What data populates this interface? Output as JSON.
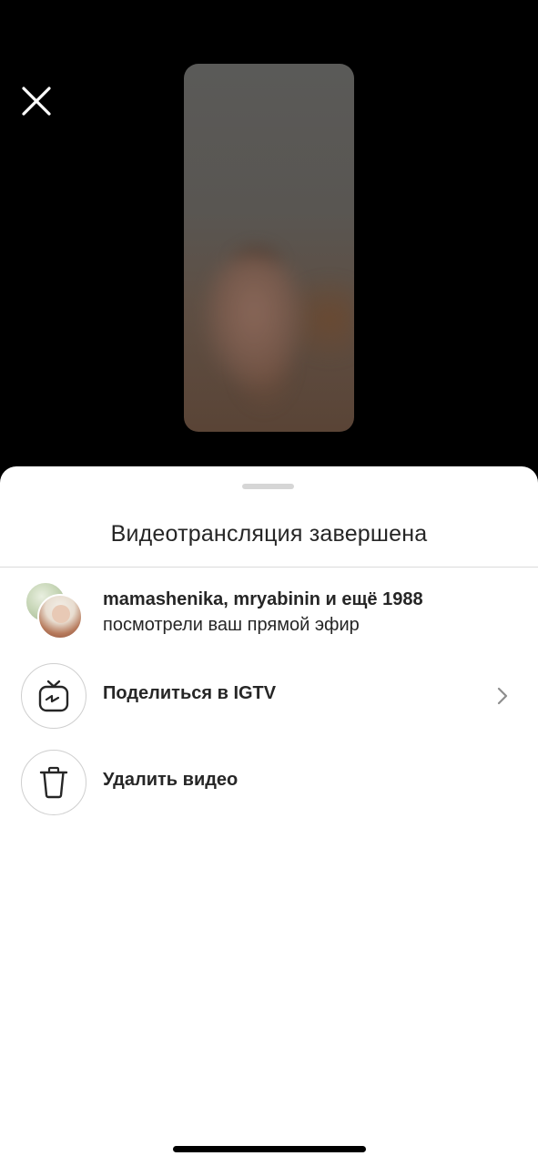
{
  "top": {
    "close_icon": "close-icon"
  },
  "sheet": {
    "title": "Видеотрансляция завершена",
    "viewers": {
      "line1": "mamashenika, mryabinin и ещё 1988",
      "line2": "посмотрели ваш прямой эфир"
    },
    "actions": [
      {
        "label": "Поделиться в IGTV",
        "icon": "igtv-icon",
        "has_chevron": true
      },
      {
        "label": "Удалить видео",
        "icon": "trash-icon",
        "has_chevron": false
      }
    ]
  },
  "colors": {
    "background": "#000000",
    "sheet": "#ffffff",
    "text": "#262626",
    "divider": "#dbdbdb"
  }
}
